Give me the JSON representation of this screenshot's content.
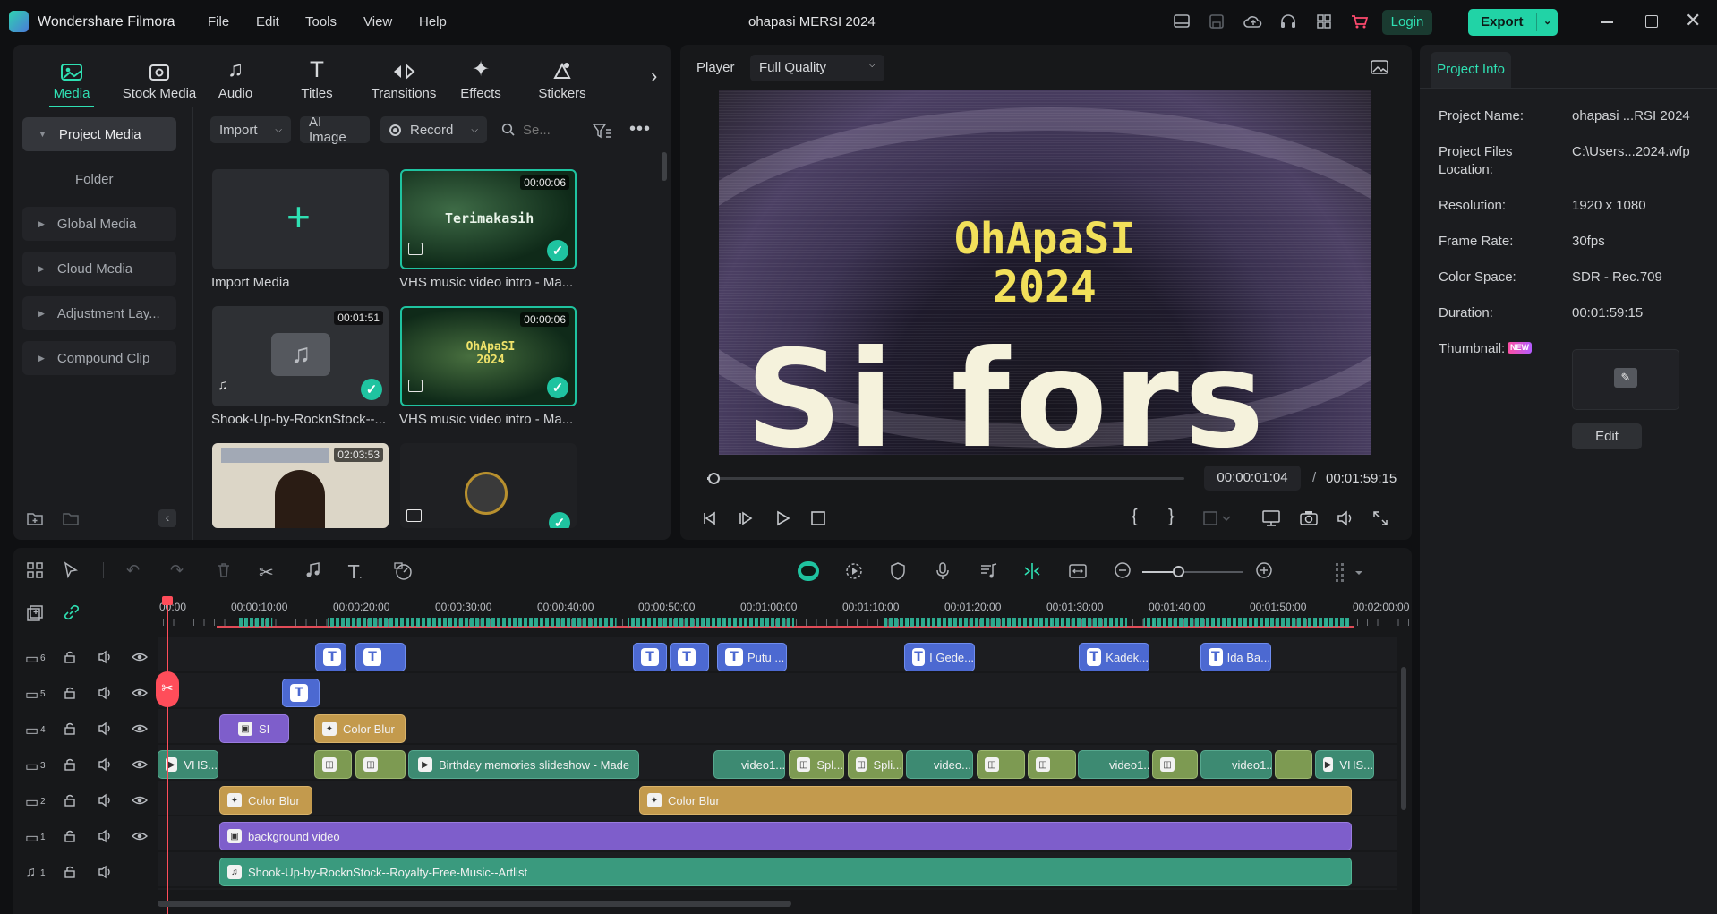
{
  "app": {
    "name": "Wondershare Filmora",
    "project_title": "ohapasi MERSI 2024"
  },
  "menu": [
    "File",
    "Edit",
    "Tools",
    "View",
    "Help"
  ],
  "titlebar": {
    "login_label": "Login",
    "export_label": "Export"
  },
  "media_tabs": [
    {
      "label": "Media",
      "icon": "media-icon",
      "active": true
    },
    {
      "label": "Stock Media",
      "icon": "stock-media-icon"
    },
    {
      "label": "Audio",
      "icon": "audio-icon"
    },
    {
      "label": "Titles",
      "icon": "titles-icon"
    },
    {
      "label": "Transitions",
      "icon": "transitions-icon"
    },
    {
      "label": "Effects",
      "icon": "effects-icon"
    },
    {
      "label": "Stickers",
      "icon": "stickers-icon"
    }
  ],
  "sidebar": {
    "project_media": "Project Media",
    "folder": "Folder",
    "items": [
      "Global Media",
      "Cloud Media",
      "Adjustment Lay...",
      "Compound Clip"
    ]
  },
  "media_toolbar": {
    "import": "Import",
    "ai_image": "AI Image",
    "record": "Record",
    "search_placeholder": "Se..."
  },
  "media_items": [
    {
      "label": "Import Media"
    },
    {
      "label": "VHS music video intro - Ma...",
      "duration": "00:00:06",
      "thumb_text": "Terimakasih"
    },
    {
      "label": "Shook-Up-by-RocknStock--...",
      "duration": "00:01:51"
    },
    {
      "label": "VHS music video intro - Ma...",
      "duration": "00:00:06",
      "thumb_text": "OhApaSI 2024"
    },
    {
      "label": "",
      "duration": "02:03:53"
    },
    {
      "label": ""
    }
  ],
  "player": {
    "label": "Player",
    "quality": "Full Quality",
    "overlay_line1": "OhApaSI",
    "overlay_line2": "2024",
    "overlay_big": "Si fors",
    "current_time": "00:00:01:04",
    "separator": "/",
    "total_time": "00:01:59:15",
    "progress": 0.009
  },
  "project_info": {
    "tab": "Project Info",
    "rows": [
      {
        "key": "Project Name:",
        "value": "ohapasi ...RSI 2024"
      },
      {
        "key": "Project Files Location:",
        "value": "C:\\Users...2024.wfp"
      },
      {
        "key": "Resolution:",
        "value": "1920 x 1080"
      },
      {
        "key": "Frame Rate:",
        "value": "30fps"
      },
      {
        "key": "Color Space:",
        "value": "SDR - Rec.709"
      },
      {
        "key": "Duration:",
        "value": "00:01:59:15"
      }
    ],
    "thumbnail_label": "Thumbnail:",
    "new_badge": "NEW",
    "edit_button": "Edit"
  },
  "ruler": [
    "00:00",
    "00:00:10:00",
    "00:00:20:00",
    "00:00:30:00",
    "00:00:40:00",
    "00:00:50:00",
    "00:01:00:00",
    "00:01:10:00",
    "00:01:20:00",
    "00:01:30:00",
    "00:01:40:00",
    "00:01:50:00",
    "00:02:00:00"
  ],
  "tracks": [
    {
      "num": "6",
      "type": "video"
    },
    {
      "num": "5",
      "type": "video"
    },
    {
      "num": "4",
      "type": "video"
    },
    {
      "num": "3",
      "type": "video"
    },
    {
      "num": "2",
      "type": "video"
    },
    {
      "num": "1",
      "type": "video"
    },
    {
      "num": "1",
      "type": "audio"
    }
  ],
  "clips": {
    "track6": [
      "",
      "",
      "",
      "",
      "Putu ...",
      "I Gede...",
      "Kadek...",
      "Ida Ba..."
    ],
    "track5": [
      ""
    ],
    "track4": [
      "SI",
      "Color Blur"
    ],
    "track3": [
      "VHS...",
      "Birthday memories slideshow - Made",
      "video1...",
      "Spl...",
      "Spli...",
      "video...",
      "video1...",
      "video1...",
      "VHS..."
    ],
    "track2": [
      "Color Blur",
      "Color Blur"
    ],
    "track1": [
      "background video"
    ],
    "audio1": [
      "Shook-Up-by-RocknStock--Royalty-Free-Music--Artlist"
    ]
  },
  "colors": {
    "accent": "#1fc3a0",
    "title_clip": "#4c69d1",
    "effect_clip": "#c39a4d",
    "video_clip": "#3d8a72",
    "bg_clip": "#7e5ecb",
    "playhead": "#ff4d5a"
  }
}
